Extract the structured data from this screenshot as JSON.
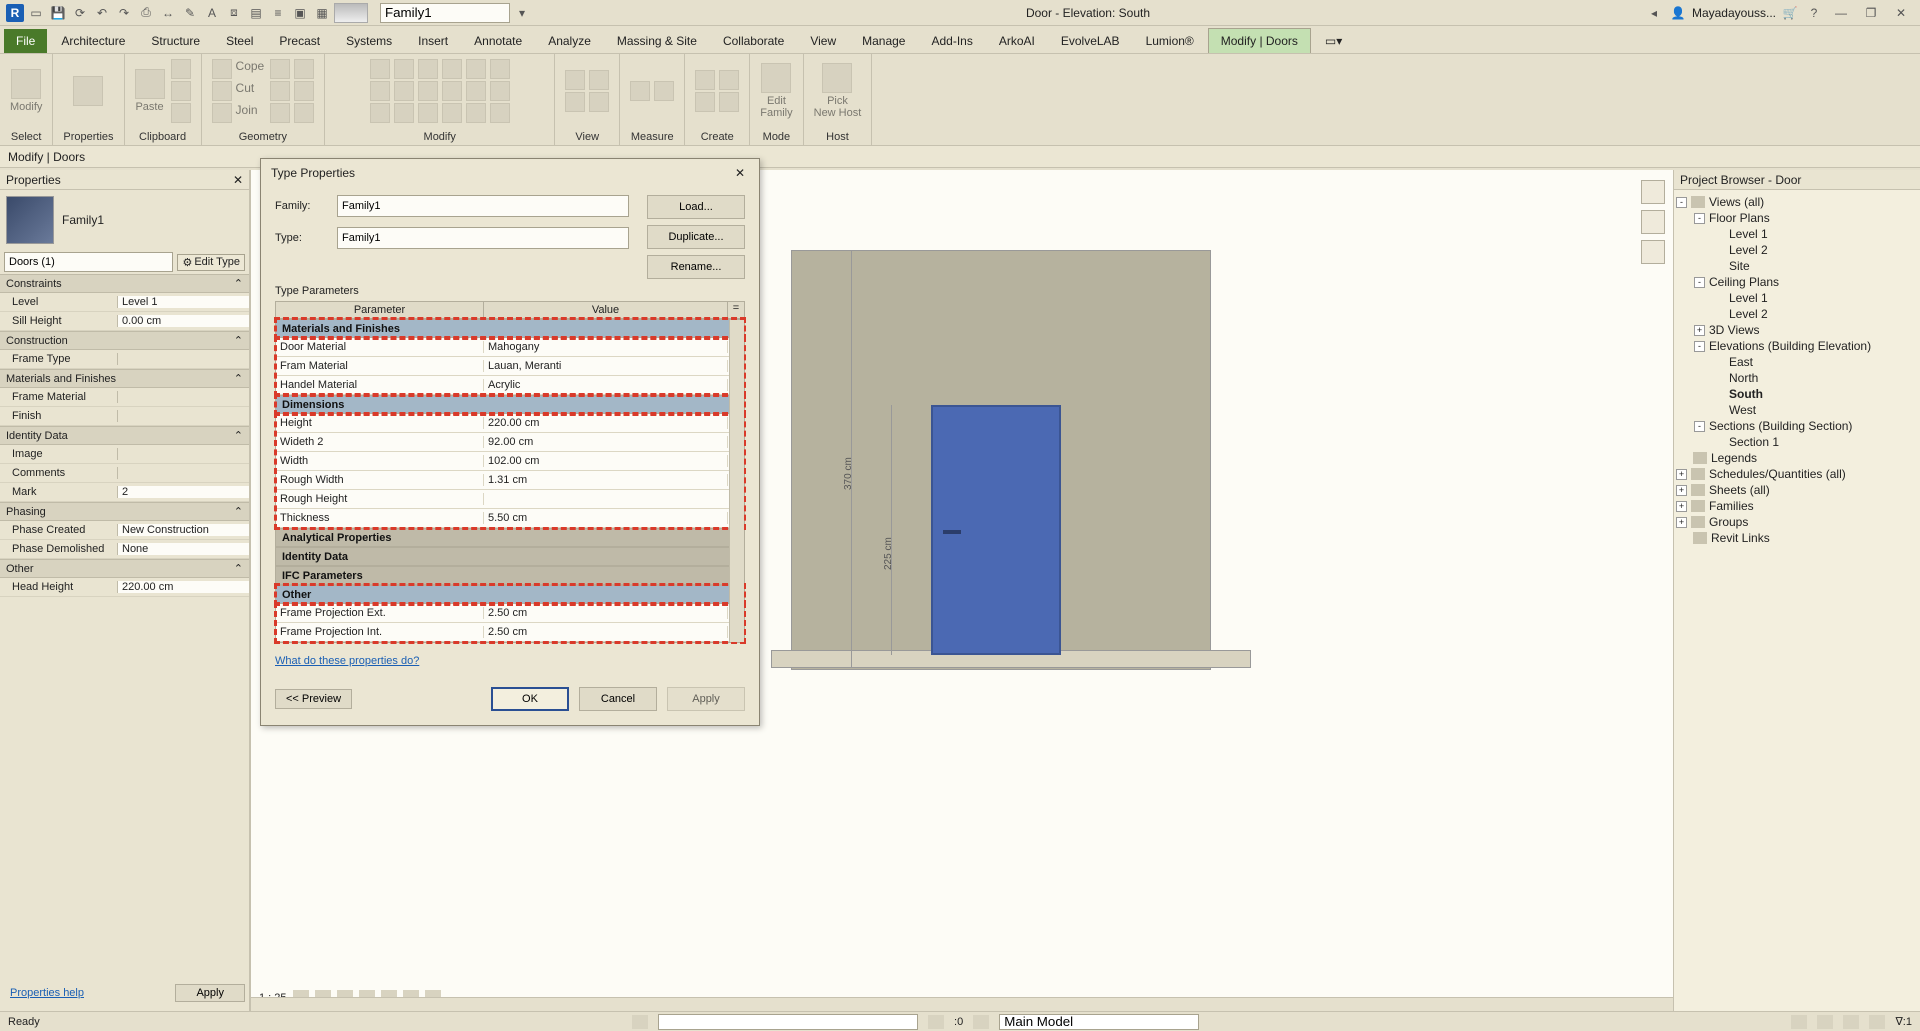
{
  "title": "Door - Elevation: South",
  "user": "Mayadayouss...",
  "qat_family_input": "Family1",
  "tabs": [
    "File",
    "Architecture",
    "Structure",
    "Steel",
    "Precast",
    "Systems",
    "Insert",
    "Annotate",
    "Analyze",
    "Massing & Site",
    "Collaborate",
    "View",
    "Manage",
    "Add-Ins",
    "ArkoAI",
    "EvolveLAB",
    "Lumion®",
    "Modify | Doors"
  ],
  "active_tab": "Modify | Doors",
  "ribbon_panels": [
    "Select",
    "Properties",
    "Clipboard",
    "Geometry",
    "Modify",
    "View",
    "Measure",
    "Create",
    "Mode",
    "Host"
  ],
  "ribbon_labels": {
    "modify_btn": "Modify",
    "paste": "Paste",
    "cope": "Cope",
    "cut": "Cut",
    "join": "Join",
    "edit_family": "Edit\nFamily",
    "pick_host": "Pick\nNew Host"
  },
  "context_bar": "Modify | Doors",
  "properties": {
    "title": "Properties",
    "family": "Family1",
    "selector": "Doors (1)",
    "edit_type": "Edit Type",
    "groups": [
      {
        "name": "Constraints",
        "rows": [
          {
            "k": "Level",
            "v": "Level 1"
          },
          {
            "k": "Sill Height",
            "v": "0.00 cm"
          }
        ]
      },
      {
        "name": "Construction",
        "rows": [
          {
            "k": "Frame Type",
            "v": ""
          }
        ]
      },
      {
        "name": "Materials and Finishes",
        "rows": [
          {
            "k": "Frame Material",
            "v": ""
          },
          {
            "k": "Finish",
            "v": ""
          }
        ]
      },
      {
        "name": "Identity Data",
        "rows": [
          {
            "k": "Image",
            "v": ""
          },
          {
            "k": "Comments",
            "v": ""
          },
          {
            "k": "Mark",
            "v": "2"
          }
        ]
      },
      {
        "name": "Phasing",
        "rows": [
          {
            "k": "Phase Created",
            "v": "New Construction"
          },
          {
            "k": "Phase Demolished",
            "v": "None"
          }
        ]
      },
      {
        "name": "Other",
        "rows": [
          {
            "k": "Head Height",
            "v": "220.00 cm"
          }
        ]
      }
    ],
    "help": "Properties help",
    "apply": "Apply"
  },
  "dialog": {
    "title": "Type Properties",
    "family_label": "Family:",
    "family_value": "Family1",
    "type_label": "Type:",
    "type_value": "Family1",
    "btn_load": "Load...",
    "btn_dup": "Duplicate...",
    "btn_ren": "Rename...",
    "tp_label": "Type Parameters",
    "col_param": "Parameter",
    "col_value": "Value",
    "groups": [
      {
        "name": "Materials and Finishes",
        "highlight": true,
        "rows": [
          {
            "k": "Door Material",
            "v": "Mahogany"
          },
          {
            "k": "Fram Material",
            "v": "Lauan, Meranti"
          },
          {
            "k": "Handel Material",
            "v": "Acrylic"
          }
        ]
      },
      {
        "name": "Dimensions",
        "highlight": true,
        "rows": [
          {
            "k": "Height",
            "v": "220.00 cm"
          },
          {
            "k": "Wideth 2",
            "v": "92.00 cm"
          },
          {
            "k": "Width",
            "v": "102.00 cm"
          },
          {
            "k": "Rough Width",
            "v": "1.31 cm"
          },
          {
            "k": "Rough Height",
            "v": ""
          },
          {
            "k": "Thickness",
            "v": "5.50 cm"
          }
        ]
      },
      {
        "name": "Analytical Properties",
        "grey": true,
        "rows": []
      },
      {
        "name": "Identity Data",
        "grey": true,
        "rows": []
      },
      {
        "name": "IFC Parameters",
        "grey": true,
        "rows": []
      },
      {
        "name": "Other",
        "highlight": true,
        "rows": [
          {
            "k": "Frame Projection Ext.",
            "v": "2.50 cm"
          },
          {
            "k": "Frame Projection Int.",
            "v": "2.50 cm"
          }
        ]
      }
    ],
    "help": "What do these properties do?",
    "preview": "<< Preview",
    "ok": "OK",
    "cancel": "Cancel",
    "apply": "Apply"
  },
  "browser": {
    "title": "Project Browser - Door",
    "nodes": [
      {
        "lvl": 0,
        "exp": "-",
        "ico": true,
        "label": "Views (all)",
        "bold": false
      },
      {
        "lvl": 1,
        "exp": "-",
        "label": "Floor Plans"
      },
      {
        "lvl": 2,
        "label": "Level 1"
      },
      {
        "lvl": 2,
        "label": "Level 2"
      },
      {
        "lvl": 2,
        "label": "Site"
      },
      {
        "lvl": 1,
        "exp": "-",
        "label": "Ceiling Plans"
      },
      {
        "lvl": 2,
        "label": "Level 1"
      },
      {
        "lvl": 2,
        "label": "Level 2"
      },
      {
        "lvl": 1,
        "exp": "+",
        "label": "3D Views"
      },
      {
        "lvl": 1,
        "exp": "-",
        "label": "Elevations (Building Elevation)"
      },
      {
        "lvl": 2,
        "label": "East"
      },
      {
        "lvl": 2,
        "label": "North"
      },
      {
        "lvl": 2,
        "label": "South",
        "bold": true
      },
      {
        "lvl": 2,
        "label": "West"
      },
      {
        "lvl": 1,
        "exp": "-",
        "label": "Sections (Building Section)"
      },
      {
        "lvl": 2,
        "label": "Section 1"
      },
      {
        "lvl": 0,
        "exp": " ",
        "ico": true,
        "label": "Legends"
      },
      {
        "lvl": 0,
        "exp": "+",
        "ico": true,
        "label": "Schedules/Quantities (all)"
      },
      {
        "lvl": 0,
        "exp": "+",
        "ico": true,
        "label": "Sheets (all)"
      },
      {
        "lvl": 0,
        "exp": "+",
        "ico": true,
        "label": "Families"
      },
      {
        "lvl": 0,
        "exp": "+",
        "ico": true,
        "label": "Groups"
      },
      {
        "lvl": 0,
        "exp": " ",
        "ico": true,
        "label": "Revit Links"
      }
    ]
  },
  "drawing": {
    "dim_full": "370 cm",
    "dim_door": "225 cm"
  },
  "view_controls": {
    "scale": "1 : 25"
  },
  "status": {
    "ready": "Ready",
    "zero": ":0",
    "model": "Main Model",
    "filter": "∇:1"
  }
}
